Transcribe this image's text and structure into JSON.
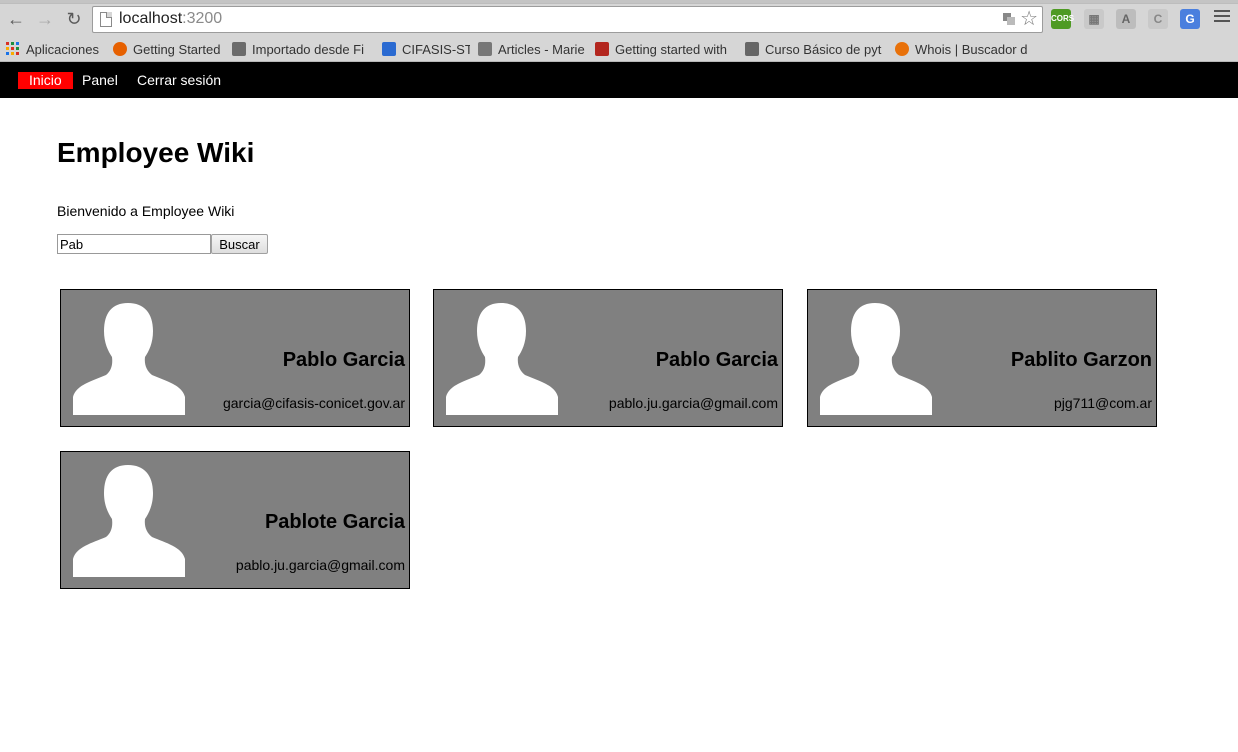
{
  "browser": {
    "url_host": "localhost",
    "url_port": ":3200",
    "bookmarks": [
      {
        "label": "Aplicaciones",
        "icon": "apps-grid-icon",
        "color": "#d93025"
      },
      {
        "label": "Getting Started",
        "icon": "firefox-icon",
        "color": "#e66000"
      },
      {
        "label": "Importado desde Fi",
        "icon": "folder-icon",
        "color": "#666666"
      },
      {
        "label": "CIFASIS-ST",
        "icon": "cifasis-icon",
        "color": "#2a6ad1"
      },
      {
        "label": "Articles - Marie",
        "icon": "feather-icon",
        "color": "#555555"
      },
      {
        "label": "Getting started with",
        "icon": "hat-icon",
        "color": "#b3261e"
      },
      {
        "label": "Curso Básico de pyt",
        "icon": "python-icon",
        "color": "#555555"
      },
      {
        "label": "Whois | Buscador d",
        "icon": "whois-icon",
        "color": "#e8710a"
      }
    ]
  },
  "nav": {
    "items": [
      {
        "label": "Inicio",
        "active": true
      },
      {
        "label": "Panel",
        "active": false
      },
      {
        "label": "Cerrar sesión",
        "active": false
      }
    ]
  },
  "main": {
    "title": "Employee Wiki",
    "welcome": "Bienvenido a Employee Wiki",
    "search_value": "Pab",
    "search_button": "Buscar"
  },
  "employees": [
    {
      "name": "Pablo Garcia",
      "email": "garcia@cifasis-conicet.gov.ar"
    },
    {
      "name": "Pablo Garcia",
      "email": "pablo.ju.garcia@gmail.com"
    },
    {
      "name": "Pablito Garzon",
      "email": "pjg711@com.ar"
    },
    {
      "name": "Pablote Garcia",
      "email": "pablo.ju.garcia@gmail.com"
    }
  ],
  "colors": {
    "nav_bg": "#000000",
    "active_nav": "#ff0000",
    "card_bg": "#808080"
  }
}
